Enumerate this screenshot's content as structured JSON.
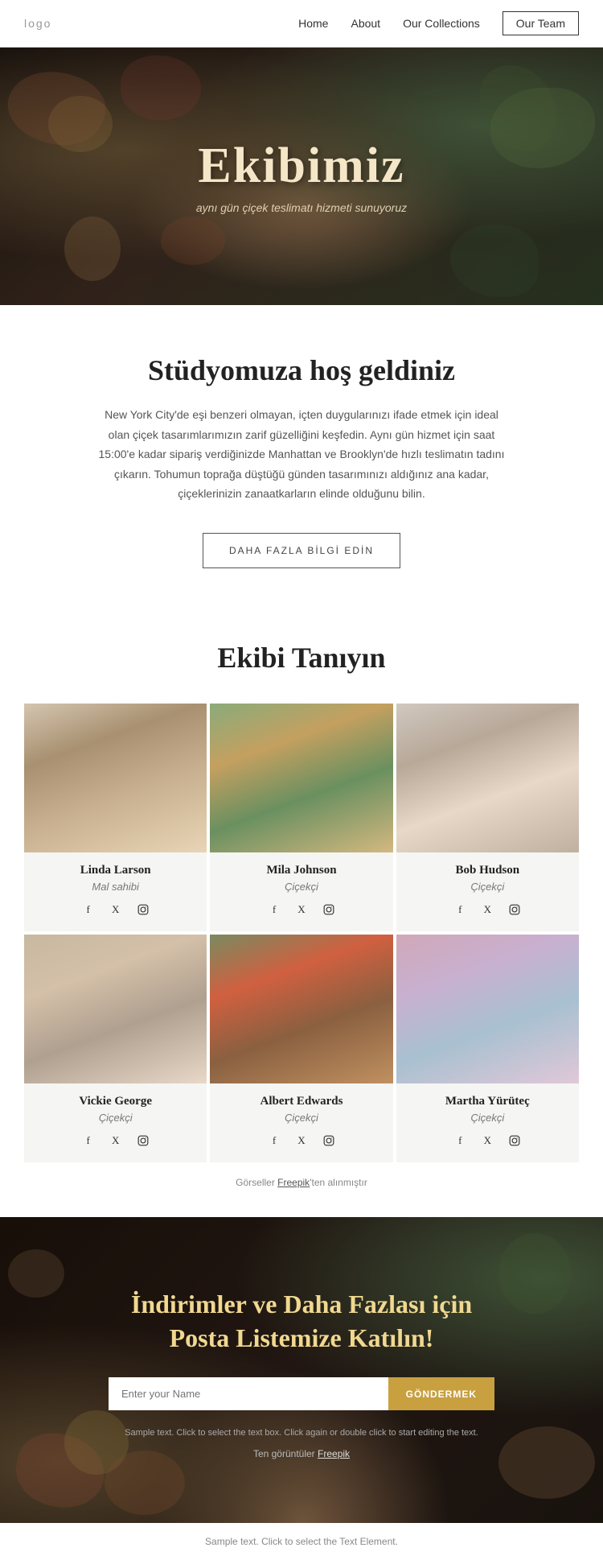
{
  "nav": {
    "logo": "logo",
    "links": [
      "Home",
      "About",
      "Our Collections"
    ],
    "cta_label": "Our Team"
  },
  "hero": {
    "title": "Ekibimiz",
    "subtitle": "aynı gün çiçek teslimatı hizmeti sunuyoruz"
  },
  "welcome": {
    "heading": "Stüdyomuza hoş geldiniz",
    "body": "New York City'de eşi benzeri olmayan, içten duygularınızı ifade etmek için ideal olan çiçek tasarımlarımızın zarif güzelliğini keşfedin. Aynı gün hizmet için saat 15:00'e kadar sipariş verdiğinizde Manhattan ve Brooklyn'de hızlı teslimatın tadını çıkarın. Tohumun toprağa düştüğü günden tasarımınızı aldığınız ana kadar, çiçeklerinizin zanaatkarların elinde olduğunu bilin.",
    "btn_label": "DAHA FAZLA BİLGİ EDİN"
  },
  "team_section": {
    "heading": "Ekibi Tanıyın",
    "members": [
      {
        "name": "Linda Larson",
        "role": "Mal sahibi",
        "img_class": "img-linda"
      },
      {
        "name": "Mila Johnson",
        "role": "Çiçekçi",
        "img_class": "img-mila"
      },
      {
        "name": "Bob Hudson",
        "role": "Çiçekçi",
        "img_class": "img-bob"
      },
      {
        "name": "Vickie George",
        "role": "Çiçekçi",
        "img_class": "img-vickie"
      },
      {
        "name": "Albert Edwards",
        "role": "Çiçekçi",
        "img_class": "img-albert"
      },
      {
        "name": "Martha Yürüteç",
        "role": "Çiçekçi",
        "img_class": "img-martha"
      }
    ]
  },
  "freepik_note": "Görseller ",
  "freepik_link": "Freepik",
  "freepik_suffix": "'ten alınmıştır",
  "newsletter": {
    "heading": "İndirimler ve Daha Fazlası için\nPosta Listemize Katılın!",
    "input_placeholder": "Enter your Name",
    "btn_label": "GÖNDERMEK",
    "sample_text": "Sample text. Click to select the text box. Click again or double click to start editing the text.",
    "freepik_text": "Ten görüntüler ",
    "freepik_link": "Freepik"
  },
  "footer": {
    "sample": "Sample text. Click to select the Text Element."
  }
}
